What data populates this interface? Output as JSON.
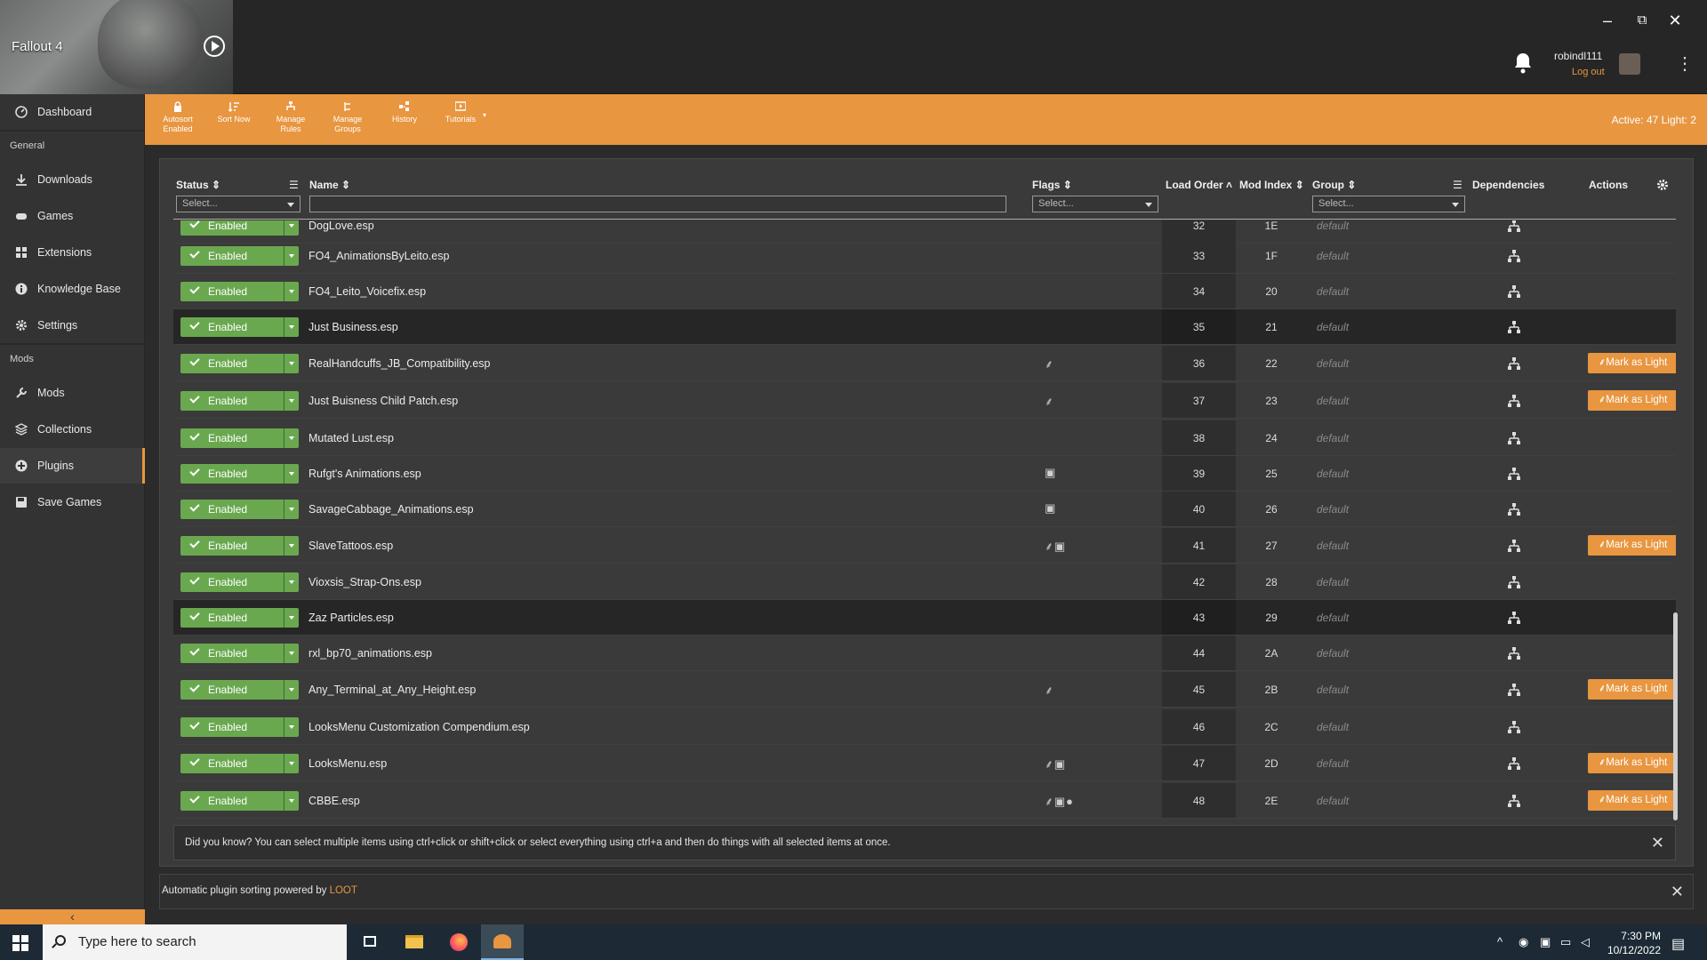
{
  "window": {
    "game_title": "Fallout 4",
    "minimize": "–",
    "restore": "⧉",
    "close": "✕"
  },
  "user": {
    "name": "robindl111",
    "logout": "Log out"
  },
  "sidebar": {
    "dashboard": "Dashboard",
    "section_general": "General",
    "downloads": "Downloads",
    "games": "Games",
    "extensions": "Extensions",
    "knowledge_base": "Knowledge Base",
    "settings": "Settings",
    "section_mods": "Mods",
    "mods": "Mods",
    "collections": "Collections",
    "plugins": "Plugins",
    "save_games": "Save Games",
    "collapse": "‹"
  },
  "toolbar": {
    "autosort": [
      "Autosort",
      "Enabled"
    ],
    "sort_now": "Sort Now",
    "manage_rules": [
      "Manage",
      "Rules"
    ],
    "manage_groups": [
      "Manage",
      "Groups"
    ],
    "history": "History",
    "tutorials": "Tutorials",
    "active_count": "Active: 47 Light: 2"
  },
  "table": {
    "headers": {
      "status": "Status",
      "name": "Name",
      "flags": "Flags",
      "load_order": "Load Order",
      "mod_index": "Mod Index",
      "group": "Group",
      "dependencies": "Dependencies",
      "actions": "Actions"
    },
    "filter_placeholder": "Select...",
    "status_label": "Enabled",
    "group_default": "default",
    "action_label": "Mark as Light",
    "rows": [
      {
        "name": "DogLove.esp",
        "lo": "32",
        "mi": "1E",
        "flags": "",
        "action": false,
        "hl": false
      },
      {
        "name": "FO4_AnimationsByLeito.esp",
        "lo": "33",
        "mi": "1F",
        "flags": "",
        "action": false,
        "hl": false
      },
      {
        "name": "FO4_Leito_Voicefix.esp",
        "lo": "34",
        "mi": "20",
        "flags": "",
        "action": false,
        "hl": false
      },
      {
        "name": "Just Business.esp",
        "lo": "35",
        "mi": "21",
        "flags": "",
        "action": false,
        "hl": true
      },
      {
        "name": "RealHandcuffs_JB_Compatibility.esp",
        "lo": "36",
        "mi": "22",
        "flags": "feather",
        "action": true,
        "hl": false
      },
      {
        "name": "Just Buisness Child Patch.esp",
        "lo": "37",
        "mi": "23",
        "flags": "feather",
        "action": true,
        "hl": false
      },
      {
        "name": "Mutated Lust.esp",
        "lo": "38",
        "mi": "24",
        "flags": "",
        "action": false,
        "hl": false
      },
      {
        "name": "Rufgt's Animations.esp",
        "lo": "39",
        "mi": "25",
        "flags": "archive",
        "action": false,
        "hl": false
      },
      {
        "name": "SavageCabbage_Animations.esp",
        "lo": "40",
        "mi": "26",
        "flags": "archive",
        "action": false,
        "hl": false
      },
      {
        "name": "SlaveTattoos.esp",
        "lo": "41",
        "mi": "27",
        "flags": "feather archive",
        "action": true,
        "hl": false
      },
      {
        "name": "Vioxsis_Strap-Ons.esp",
        "lo": "42",
        "mi": "28",
        "flags": "",
        "action": false,
        "hl": false
      },
      {
        "name": "Zaz Particles.esp",
        "lo": "43",
        "mi": "29",
        "flags": "",
        "action": false,
        "hl": true
      },
      {
        "name": "rxl_bp70_animations.esp",
        "lo": "44",
        "mi": "2A",
        "flags": "",
        "action": false,
        "hl": false
      },
      {
        "name": "Any_Terminal_at_Any_Height.esp",
        "lo": "45",
        "mi": "2B",
        "flags": "feather",
        "action": true,
        "hl": false
      },
      {
        "name": "LooksMenu Customization Compendium.esp",
        "lo": "46",
        "mi": "2C",
        "flags": "",
        "action": false,
        "hl": false
      },
      {
        "name": "LooksMenu.esp",
        "lo": "47",
        "mi": "2D",
        "flags": "feather archive",
        "action": true,
        "hl": false
      },
      {
        "name": "CBBE.esp",
        "lo": "48",
        "mi": "2E",
        "flags": "feather archive drop",
        "action": true,
        "hl": false
      }
    ]
  },
  "tip": "Did you know? You can select multiple items using ctrl+click or shift+click or select everything using ctrl+a and then do things with all selected items at once.",
  "footer": {
    "text": "Automatic plugin sorting powered by ",
    "link": "LOOT"
  },
  "taskbar": {
    "search_placeholder": "Type here to search",
    "time": "7:30 PM",
    "date": "10/12/2022"
  },
  "colors": {
    "accent": "#e89640",
    "enabled": "#6aa84f"
  }
}
